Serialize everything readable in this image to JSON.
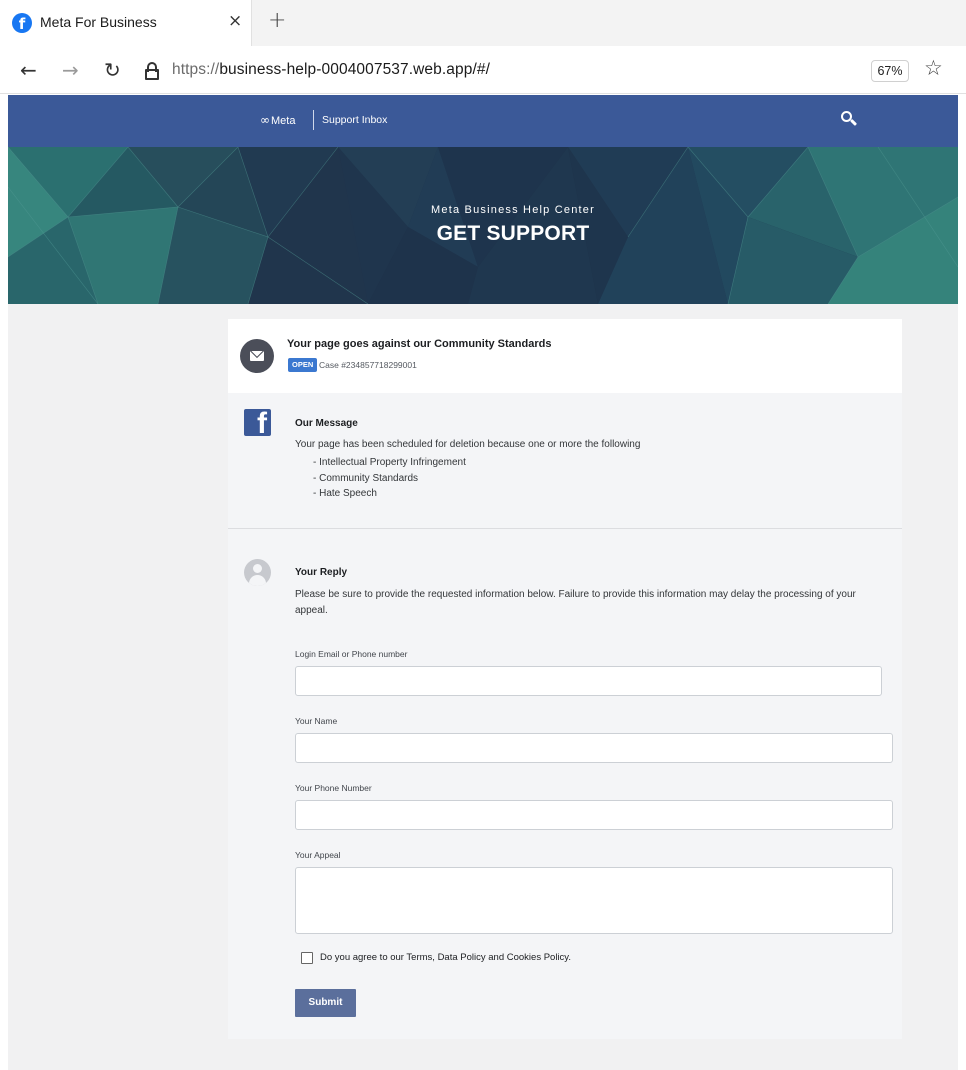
{
  "browser": {
    "tab_title": "Meta For Business",
    "favicon_glyph": "f",
    "close_glyph": "×",
    "new_tab_glyph": "+",
    "back_glyph": "←",
    "forward_glyph": "→",
    "reload_glyph": "↻",
    "url_scheme": "https://",
    "url_host": "business-help-0004007537.web.app/#/",
    "zoom": "67%",
    "star_glyph": "☆",
    "icons": [
      "facebook-favicon-icon",
      "close-icon",
      "plus-icon",
      "back-arrow-icon",
      "forward-arrow-icon",
      "reload-icon",
      "lock-icon",
      "star-icon"
    ]
  },
  "nav": {
    "brand_symbol": "∞",
    "brand": "Meta",
    "support_link": "Support Inbox",
    "icons": [
      "search-icon"
    ],
    "background": "#3b5998"
  },
  "hero": {
    "subtitle": "Meta Business Help Center",
    "title": "GET SUPPORT"
  },
  "case": {
    "title": "Your page goes against our Community Standards",
    "status": "OPEN",
    "case_number": "Case #234857718299001",
    "status_color": "#3b78d0"
  },
  "message": {
    "heading": "Our Message",
    "text": "Your page has been scheduled for deletion because one or more the following",
    "items": [
      "- Intellectual Property Infringement",
      "- Community Standards",
      "- Hate Speech"
    ],
    "logo_glyph": "f"
  },
  "reply": {
    "heading": "Your Reply",
    "intro": "Please be sure to provide the requested information below. Failure to provide this information may delay the processing of your appeal.",
    "fields": {
      "email_label": "Login Email or Phone number",
      "email_value": "",
      "name_label": "Your Name",
      "name_value": "",
      "phone_label": "Your Phone Number",
      "phone_value": "",
      "appeal_label": "Your Appeal",
      "appeal_value": ""
    },
    "agree_text": "Do you agree to our Terms, Data Policy and Cookies Policy.",
    "agree_checked": false,
    "submit_label": "Submit",
    "submit_color": "#5b6f9c"
  }
}
